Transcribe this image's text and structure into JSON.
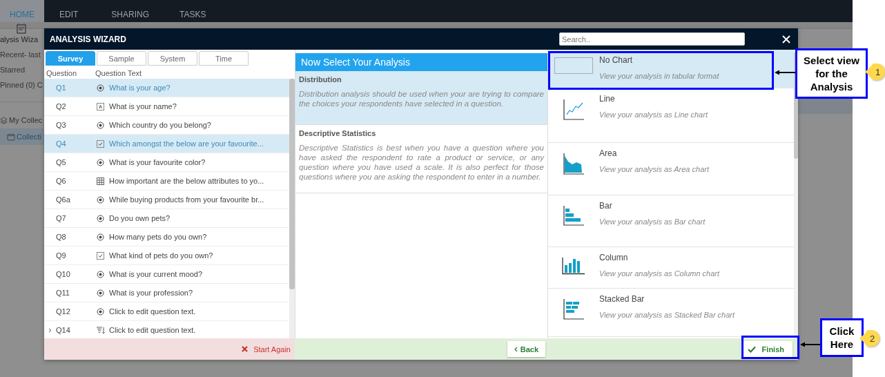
{
  "background": {
    "tabs": [
      {
        "label": "HOME",
        "selected": true
      },
      {
        "label": "EDIT",
        "selected": false
      },
      {
        "label": "SHARING",
        "selected": false
      },
      {
        "label": "TASKS",
        "selected": false
      }
    ],
    "sidebar": {
      "heading": "alysis Wiza",
      "items": [
        "Recent- last",
        "Starred",
        "Pinned (0) C"
      ],
      "tree": [
        {
          "label": "My Collec",
          "kind": "stack",
          "selected": false
        },
        {
          "label": "Collecti",
          "kind": "folder",
          "selected": true
        }
      ]
    }
  },
  "dialog": {
    "title": "ANALYSIS WIZARD",
    "search": {
      "placeholder": "Search.."
    },
    "tabs": [
      {
        "label": "Survey",
        "selected": true
      },
      {
        "label": "Sample",
        "selected": false
      },
      {
        "label": "System",
        "selected": false
      },
      {
        "label": "Time",
        "selected": false
      }
    ],
    "table": {
      "columns": [
        "Question",
        "Question Text"
      ],
      "rows": [
        {
          "id": "Q1",
          "kind": "radio",
          "text": "What is your age?",
          "selected": true,
          "expandable": false
        },
        {
          "id": "Q2",
          "kind": "text",
          "text": "What is your name?",
          "selected": false,
          "expandable": false
        },
        {
          "id": "Q3",
          "kind": "radio",
          "text": "Which country do you belong?",
          "selected": false,
          "expandable": false
        },
        {
          "id": "Q4",
          "kind": "checkbox",
          "text": "Which amongst the below are your favourite...",
          "selected": true,
          "expandable": false
        },
        {
          "id": "Q5",
          "kind": "radio",
          "text": "What is your favourite color?",
          "selected": false,
          "expandable": false
        },
        {
          "id": "Q6",
          "kind": "grid",
          "text": "How important are the below attributes to yo...",
          "selected": false,
          "expandable": false
        },
        {
          "id": "Q6a",
          "kind": "radio",
          "text": "While buying products from your favourite br...",
          "selected": false,
          "expandable": false
        },
        {
          "id": "Q7",
          "kind": "radio",
          "text": "Do you own pets?",
          "selected": false,
          "expandable": false
        },
        {
          "id": "Q8",
          "kind": "radio",
          "text": "How many pets do you own?",
          "selected": false,
          "expandable": false
        },
        {
          "id": "Q9",
          "kind": "checkbox",
          "text": "What kind of pets do you own?",
          "selected": false,
          "expandable": false
        },
        {
          "id": "Q10",
          "kind": "radio",
          "text": "What is your current mood?",
          "selected": false,
          "expandable": false
        },
        {
          "id": "Q11",
          "kind": "radio",
          "text": "What is your profession?",
          "selected": false,
          "expandable": false
        },
        {
          "id": "Q12",
          "kind": "radio",
          "text": "Click to edit question text.",
          "selected": false,
          "expandable": false
        },
        {
          "id": "Q14",
          "kind": "ranking",
          "text": "Click to edit question text.",
          "selected": false,
          "expandable": true
        }
      ]
    },
    "start_again": "Start Again",
    "analysis": {
      "title": "Now Select Your Analysis",
      "options": [
        {
          "title": "Distribution",
          "description": "Distribution analysis should be used when your are trying to compare the choices your respondents have selected in a question.",
          "selected": true
        },
        {
          "title": "Descriptive Statistics",
          "description": "Descriptive Statistics is best when you have a question where you have asked the respondent to rate a product or service, or any question where you have used a scale. It is also perfect for those questions where you are asking the respondent to enter in a number.",
          "selected": false
        }
      ]
    },
    "back": "Back",
    "charts": [
      {
        "kind": "none",
        "title": "No Chart",
        "description": "View your analysis in tabular format",
        "selected": true
      },
      {
        "kind": "line",
        "title": "Line",
        "description": "View your analysis as Line chart",
        "selected": false
      },
      {
        "kind": "area",
        "title": "Area",
        "description": "View your analysis as Area chart",
        "selected": false
      },
      {
        "kind": "bar",
        "title": "Bar",
        "description": "View your analysis as Bar chart",
        "selected": false
      },
      {
        "kind": "column",
        "title": "Column",
        "description": "View your analysis as Column chart",
        "selected": false
      },
      {
        "kind": "stacked",
        "title": "Stacked Bar",
        "description": "View your analysis as Stacked Bar chart",
        "selected": false
      }
    ],
    "finish": "Finish"
  },
  "callouts": [
    {
      "number": "1",
      "text": "Select view for the Analysis",
      "kind": "chart"
    },
    {
      "number": "2",
      "text": "Click Here",
      "kind": "finish"
    }
  ]
}
